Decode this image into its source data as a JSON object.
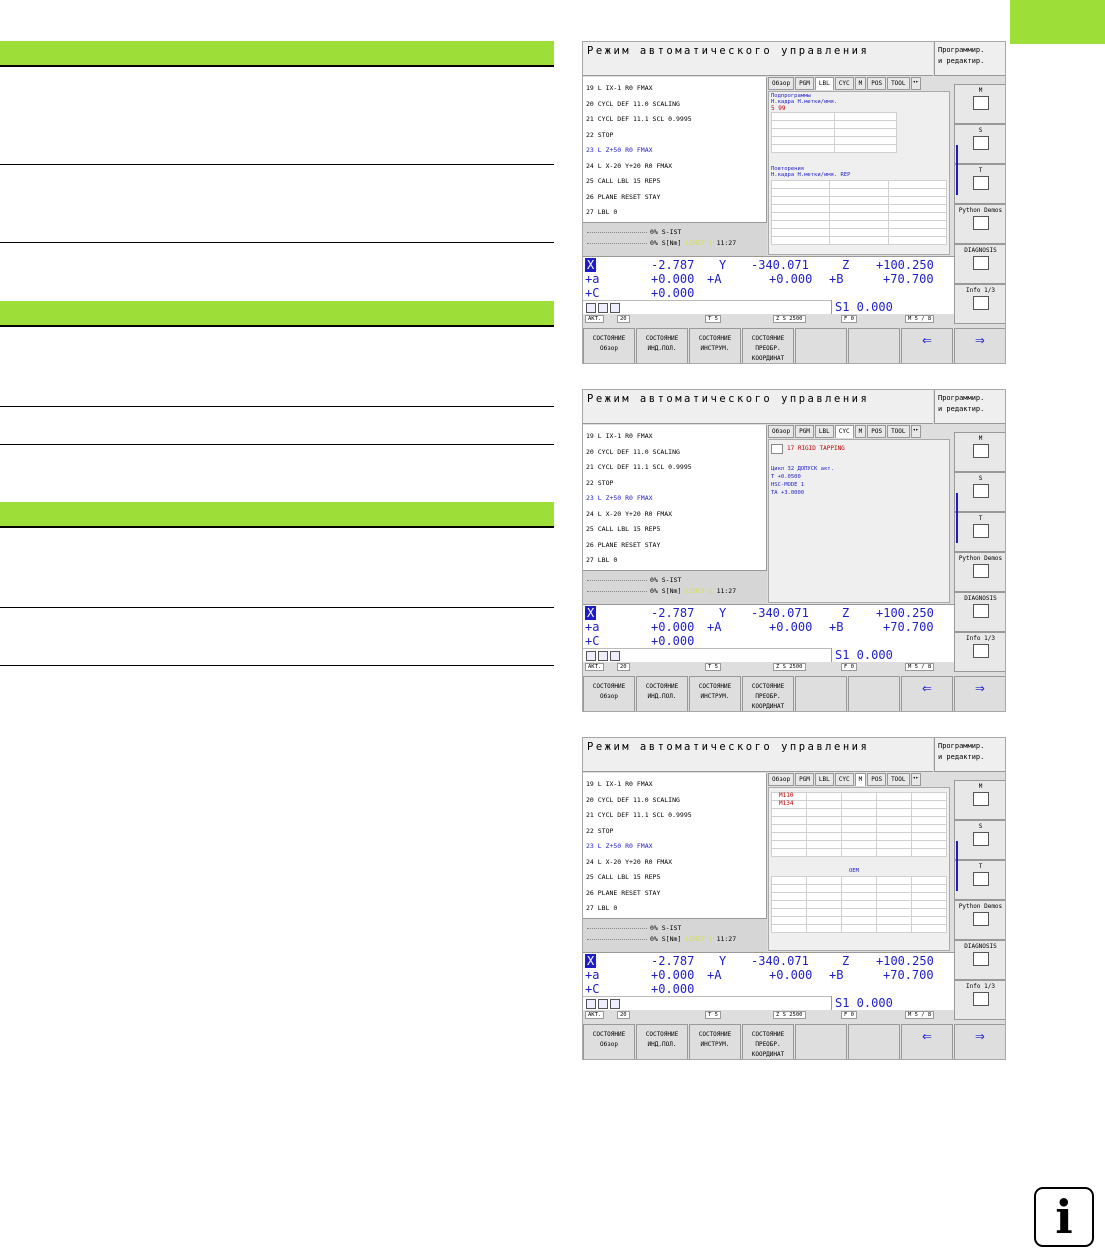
{
  "screens": [
    {
      "title": "Режим автоматического управления",
      "mode": [
        "Программир.",
        "и редактир."
      ],
      "program": [
        {
          "text": "19 L IX-1 R0 FMAX",
          "blue": false
        },
        {
          "text": "20 CYCL DEF 11.0 SCALING",
          "blue": false
        },
        {
          "text": "21 CYCL DEF 11.1 SCL 0.9995",
          "blue": false
        },
        {
          "text": "22 STOP",
          "blue": false
        },
        {
          "text": "23 L  Z+50 R0 FMAX",
          "blue": true
        },
        {
          "text": "24 L  X-20  Y+20 R0 FMAX",
          "blue": false
        },
        {
          "text": "25 CALL LBL 15 REP5",
          "blue": false
        },
        {
          "text": "26 PLANE RESET STAY",
          "blue": false
        },
        {
          "text": "27 LBL 0",
          "blue": false
        }
      ],
      "status": {
        "line1": "0% S-IST",
        "line2": "0% S[Nm]",
        "limit": "LIMIT 1",
        "time": "11:27"
      },
      "tabs": [
        "Обзор",
        "PGM",
        "LBL",
        "CYC",
        "M",
        "POS",
        "TOOL"
      ],
      "active_tab": "LBL",
      "positions": {
        "x_label": "X",
        "x": "-2.787",
        "y_label": "Y",
        "y": "-340.071",
        "z_label": "Z",
        "z": "+100.250",
        "a_label": "+a",
        "a": "+0.000",
        "A_label": "+A",
        "A": "+0.000",
        "B_label": "+B",
        "B": "+70.700",
        "c_label": "+C",
        "c": "+0.000"
      },
      "s1": "S1   0.000",
      "bar": {
        "akt": "АКТ.",
        "feed": "20",
        "tool": "T 5",
        "spindle": "Z S 2500",
        "f": "F 0",
        "m": "M 5 / 8"
      },
      "softkeys": [
        [
          "СОСТОЯНИЕ",
          "Обзор"
        ],
        [
          "СОСТОЯНИЕ",
          "ИНД.ПОЛ."
        ],
        [
          "СОСТОЯНИЕ",
          "ИНСТРУМ."
        ],
        [
          "СОСТОЯНИЕ",
          "ПРЕОБР.",
          "КООРДИНАТ"
        ]
      ],
      "side": [
        "M",
        "S",
        "T",
        "Python Demos",
        "DIAGNOSIS",
        "Info 1/3"
      ],
      "lbl_panel": {
        "sub_head": "Подпрограммы",
        "cols1": "Н.кадра     Н.метки/имя.",
        "row1": "5        99",
        "rep_head": "Повторения",
        "cols2": "Н.кадра     Н.метки/имя.          REP"
      }
    },
    {
      "title": "Режим автоматического управления",
      "mode": [
        "Программир.",
        "и редактир."
      ],
      "active_tab": "CYC",
      "cyc_panel": {
        "cycle_icon": "CYCL DEF",
        "cycle": "17  RIGID TAPPING",
        "head": "Цикл 32 ДОПУСК акт.",
        "t": "T        +0.0500",
        "hsc": "HSC-MODE 1",
        "ta": "TA       +3.0000"
      }
    },
    {
      "title": "Режим автоматического управления",
      "mode": [
        "Программир.",
        "и редактир."
      ],
      "active_tab": "M",
      "m_panel": {
        "m1": "M110",
        "m2": "M134",
        "oem": "OEM"
      }
    }
  ]
}
